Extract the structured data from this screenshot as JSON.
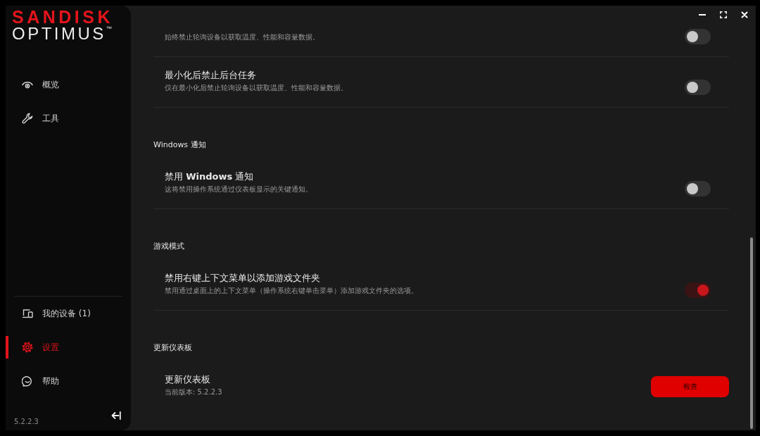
{
  "logo": {
    "brand": "SANDISK",
    "product": "OPTIMUS",
    "mark": "™"
  },
  "sidebar": {
    "nav": [
      {
        "label": "概览",
        "selected": false
      },
      {
        "label": "工具",
        "selected": false
      }
    ],
    "bottom_nav": [
      {
        "label": "我的设备 (1)",
        "selected": false
      },
      {
        "label": "设置",
        "selected": true
      },
      {
        "label": "帮助",
        "selected": false
      }
    ],
    "version": "5.2.2.3"
  },
  "sections": [
    {
      "rows": [
        {
          "kind": "toggle",
          "description": "始终禁止轮询设备以获取温度、性能和容量数据。",
          "on": false
        },
        {
          "kind": "toggle",
          "title": "最小化后禁止后台任务",
          "description": "仅在最小化后禁止轮询设备以获取温度、性能和容量数据。",
          "on": false
        }
      ]
    },
    {
      "title": "Windows 通知",
      "rows": [
        {
          "kind": "toggle",
          "title": "禁用 **Windows** 通知",
          "description": "这将禁用操作系统通过仪表板显示的关键通知。",
          "on": false
        }
      ]
    },
    {
      "title": "游戏模式",
      "rows": [
        {
          "kind": "toggle",
          "title": "禁用右键上下文菜单以添加游戏文件夹",
          "description": "禁用通过桌面上的上下文菜单（操作系统右键单击菜单）添加游戏文件夹的选项。",
          "on": true
        }
      ]
    },
    {
      "title": "更新仪表板",
      "rows": [
        {
          "kind": "button",
          "title": "更新仪表板",
          "description": "当前版本: 5.2.2.3",
          "button": "检查"
        }
      ]
    }
  ]
}
